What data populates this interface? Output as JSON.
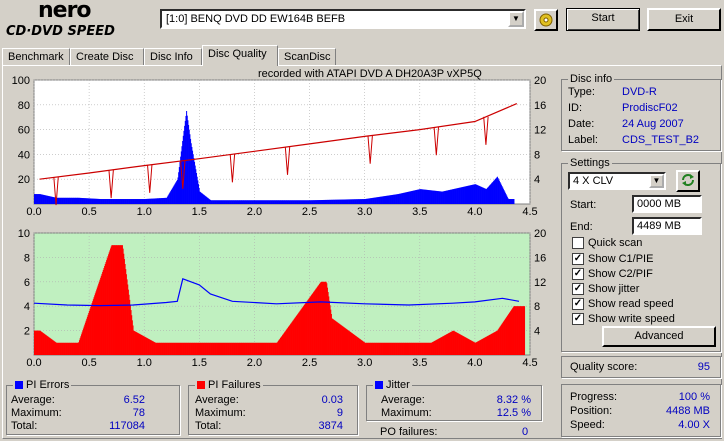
{
  "header": {
    "logo_top": "nero",
    "logo_bottom": "CD·DVD SPEED",
    "drive": "[1:0]  BENQ DVD DD EW164B BEFB",
    "start_label": "Start",
    "exit_label": "Exit"
  },
  "tabs": [
    "Benchmark",
    "Create Disc",
    "Disc Info",
    "Disc Quality",
    "ScanDisc"
  ],
  "recorded_with": "recorded with ATAPI    DVD A   DH20A3P    vXP5Q",
  "disc_info": {
    "title": "Disc info",
    "type_label": "Type:",
    "type": "DVD-R",
    "id_label": "ID:",
    "id": "ProdiscF02",
    "date_label": "Date:",
    "date": "24 Aug 2007",
    "label_label": "Label:",
    "label": "CDS_TEST_B2"
  },
  "settings": {
    "title": "Settings",
    "speed": "4 X CLV",
    "start_label": "Start:",
    "start": "0000 MB",
    "end_label": "End:",
    "end": "4489 MB",
    "quick_scan": "Quick scan",
    "show_c1": "Show C1/PIE",
    "show_c2": "Show C2/PIF",
    "show_jitter": "Show jitter",
    "show_read": "Show read speed",
    "show_write": "Show write speed",
    "advanced": "Advanced"
  },
  "quality": {
    "label": "Quality score:",
    "value": "95"
  },
  "progress": {
    "progress_label": "Progress:",
    "progress": "100 %",
    "position_label": "Position:",
    "position": "4488 MB",
    "speed_label": "Speed:",
    "speed": "4.00 X"
  },
  "pi_errors": {
    "title": "PI Errors",
    "avg_label": "Average:",
    "avg": "6.52",
    "max_label": "Maximum:",
    "max": "78",
    "total_label": "Total:",
    "total": "117084"
  },
  "pi_failures": {
    "title": "PI Failures",
    "avg_label": "Average:",
    "avg": "0.03",
    "max_label": "Maximum:",
    "max": "9",
    "total_label": "Total:",
    "total": "3874"
  },
  "jitter": {
    "title": "Jitter",
    "avg_label": "Average:",
    "avg": "8.32 %",
    "max_label": "Maximum:",
    "max": "12.5 %",
    "po_label": "PO failures:",
    "po": "0"
  },
  "colors": {
    "pie": "#0000ff",
    "pif": "#ff0000",
    "speed": "#cc0000",
    "chart2_bg": "#c0f0c0"
  },
  "chart_data": [
    {
      "type": "bar",
      "x_ticks": [
        "0.0",
        "0.5",
        "1.0",
        "1.5",
        "2.0",
        "2.5",
        "3.0",
        "3.5",
        "4.0",
        "4.5"
      ],
      "y_left_ticks": [
        "100",
        "80",
        "60",
        "40",
        "20"
      ],
      "y_right_ticks": [
        "20",
        "16",
        "12",
        "8",
        "4"
      ],
      "xlim": [
        0,
        4.5
      ],
      "ylim_left": [
        0,
        100
      ],
      "ylim_right": [
        0,
        20
      ],
      "series": [
        {
          "values": [
            [
              0.05,
              8
            ],
            [
              0.2,
              5
            ],
            [
              0.4,
              5
            ],
            [
              0.6,
              4
            ],
            [
              0.8,
              4
            ],
            [
              1.0,
              4
            ],
            [
              1.2,
              5
            ],
            [
              1.3,
              20
            ],
            [
              1.35,
              55
            ],
            [
              1.38,
              75
            ],
            [
              1.42,
              50
            ],
            [
              1.46,
              30
            ],
            [
              1.5,
              10
            ],
            [
              1.6,
              3
            ],
            [
              2.0,
              3
            ],
            [
              2.5,
              3
            ],
            [
              3.0,
              4
            ],
            [
              3.3,
              8
            ],
            [
              3.5,
              12
            ],
            [
              3.7,
              10
            ],
            [
              3.9,
              14
            ],
            [
              4.0,
              16
            ],
            [
              4.1,
              12
            ],
            [
              4.2,
              22
            ],
            [
              4.3,
              4
            ]
          ]
        },
        {
          "values": [
            [
              0.05,
              4.0
            ],
            [
              0.5,
              5.0
            ],
            [
              1.0,
              6.2
            ],
            [
              1.5,
              7.3
            ],
            [
              2.0,
              8.5
            ],
            [
              2.5,
              9.7
            ],
            [
              3.0,
              10.9
            ],
            [
              3.5,
              12.0
            ],
            [
              4.0,
              13.3
            ],
            [
              4.38,
              16.2
            ]
          ]
        }
      ]
    },
    {
      "type": "bar",
      "x_ticks": [
        "0.0",
        "0.5",
        "1.0",
        "1.5",
        "2.0",
        "2.5",
        "3.0",
        "3.5",
        "4.0",
        "4.5"
      ],
      "y_left_ticks": [
        "10",
        "8",
        "6",
        "4",
        "2"
      ],
      "y_right_ticks": [
        "20",
        "16",
        "12",
        "8",
        "4"
      ],
      "xlim": [
        0,
        4.5
      ],
      "ylim_left": [
        0,
        10
      ],
      "ylim_right": [
        0,
        20
      ],
      "series": [
        {
          "values": [
            [
              0.05,
              2
            ],
            [
              0.2,
              1
            ],
            [
              0.4,
              1
            ],
            [
              0.7,
              9
            ],
            [
              0.75,
              9
            ],
            [
              0.8,
              9
            ],
            [
              0.9,
              2
            ],
            [
              1.1,
              1
            ],
            [
              1.5,
              1
            ],
            [
              2.0,
              1
            ],
            [
              2.2,
              1
            ],
            [
              2.6,
              6
            ],
            [
              2.65,
              6
            ],
            [
              2.7,
              3
            ],
            [
              3.0,
              1
            ],
            [
              3.4,
              1
            ],
            [
              3.6,
              1
            ],
            [
              3.8,
              2
            ],
            [
              4.0,
              1
            ],
            [
              4.2,
              2
            ],
            [
              4.35,
              4
            ],
            [
              4.4,
              4
            ]
          ]
        },
        {
          "values": [
            [
              0.0,
              8.5
            ],
            [
              0.3,
              8.2
            ],
            [
              0.6,
              8.1
            ],
            [
              0.9,
              8.2
            ],
            [
              1.2,
              8.6
            ],
            [
              1.3,
              8.8
            ],
            [
              1.35,
              12.5
            ],
            [
              1.5,
              11.5
            ],
            [
              1.6,
              10.0
            ],
            [
              1.8,
              8.8
            ],
            [
              2.2,
              8.4
            ],
            [
              2.6,
              8.7
            ],
            [
              3.0,
              8.4
            ],
            [
              3.4,
              8.2
            ],
            [
              3.8,
              8.5
            ],
            [
              4.0,
              8.7
            ],
            [
              4.25,
              9.3
            ],
            [
              4.4,
              8.8
            ]
          ]
        }
      ]
    }
  ]
}
